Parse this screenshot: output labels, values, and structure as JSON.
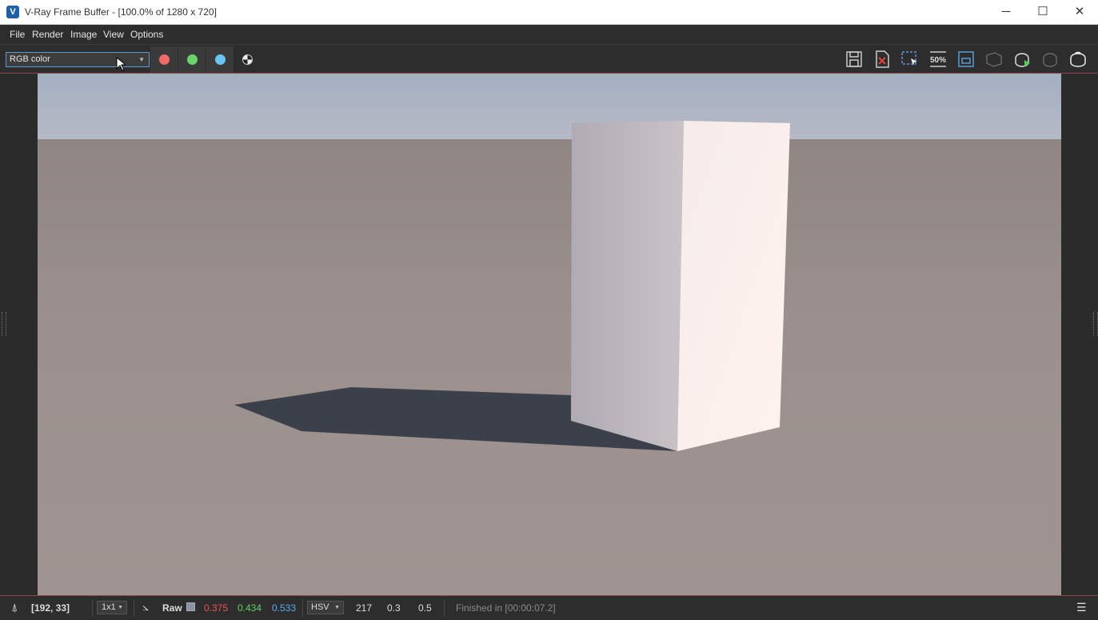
{
  "window": {
    "title": "V-Ray Frame Buffer - [100.0% of 1280 x 720]",
    "icon_letter": "V",
    "minimize_glyph": "─",
    "maximize_glyph": "☐",
    "close_glyph": "✕"
  },
  "menu": [
    "File",
    "Render",
    "Image",
    "View",
    "Options"
  ],
  "toolbar": {
    "channel": "RGB color",
    "channel_buttons": [
      {
        "name": "red-channel-button",
        "color": "#f06a6a"
      },
      {
        "name": "green-channel-button",
        "color": "#6ad36a"
      },
      {
        "name": "blue-channel-button",
        "color": "#6ac4f0"
      }
    ],
    "tools": [
      "save-icon",
      "clear-image-icon",
      "region-render-icon",
      "zoom-50-icon",
      "frame-icon",
      "stop-render-icon",
      "start-interactive-render-icon",
      "stop-interactive-render-icon",
      "render-teapot-icon"
    ],
    "zoom_label": "50%"
  },
  "status": {
    "coords": "[192, 33]",
    "zoom": "1x1",
    "mode": "Raw",
    "r": "0.375",
    "g": "0.434",
    "b": "0.533",
    "colorspace": "HSV",
    "h": "217",
    "s": "0.3",
    "v": "0.5",
    "message": "Finished in [00:00:07.2]"
  },
  "colors": {
    "accent": "#5b9bd5",
    "r_text": "#ef5050",
    "g_text": "#5fd25f",
    "b_text": "#5aaaf0"
  }
}
